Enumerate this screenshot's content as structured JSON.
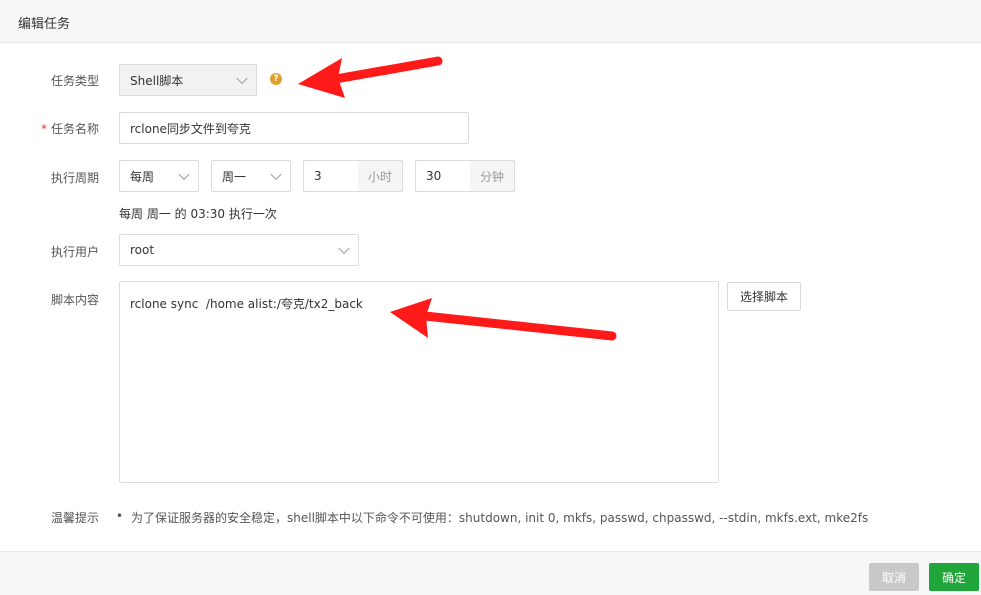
{
  "dialog": {
    "title": "编辑任务"
  },
  "form": {
    "task_type": {
      "label": "任务类型",
      "value": "Shell脚本"
    },
    "task_name": {
      "label": "任务名称",
      "required_mark": "*",
      "value": "rclone同步文件到夸克"
    },
    "period": {
      "label": "执行周期",
      "cycle": "每周",
      "weekday": "周一",
      "hour": "3",
      "hour_unit": "小时",
      "minute": "30",
      "minute_unit": "分钟",
      "summary": "每周 周一 的 03:30 执行一次"
    },
    "user": {
      "label": "执行用户",
      "value": "root"
    },
    "script": {
      "label": "脚本内容",
      "value": "rclone sync  /home alist:/夸克/tx2_back",
      "select_button": "选择脚本"
    },
    "tips": {
      "label": "温馨提示",
      "items": [
        "为了保证服务器的安全稳定，shell脚本中以下命令不可使用：shutdown, init 0, mkfs, passwd, chpasswd, --stdin, mkfs.ext, mke2fs"
      ]
    }
  },
  "footer": {
    "cancel": "取消",
    "confirm": "确定"
  },
  "colors": {
    "accent": "#20a53a",
    "arrow": "#ff1a1a",
    "help": "#e0a030"
  }
}
